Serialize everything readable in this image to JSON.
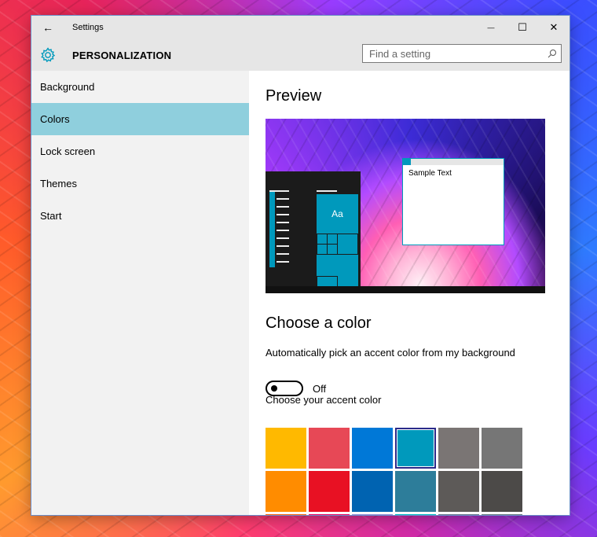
{
  "window": {
    "app_title": "Settings",
    "back_glyph": "←",
    "minimize_glyph": "—",
    "maximize_glyph": "☐",
    "close_glyph": "✕"
  },
  "header": {
    "title": "PERSONALIZATION",
    "search_placeholder": "Find a setting"
  },
  "sidebar": {
    "items": [
      {
        "label": "Background",
        "active": false
      },
      {
        "label": "Colors",
        "active": true
      },
      {
        "label": "Lock screen",
        "active": false
      },
      {
        "label": "Themes",
        "active": false
      },
      {
        "label": "Start",
        "active": false
      }
    ]
  },
  "main": {
    "preview_heading": "Preview",
    "preview": {
      "sample_text": "Sample Text",
      "tile_text": "Aa"
    },
    "choose_color_heading": "Choose a color",
    "auto_pick_label": "Automatically pick an accent color from my background",
    "toggle_state": "Off",
    "accent_label": "Choose your accent color",
    "accent_color": "#0099bc",
    "swatches": [
      [
        "#ffb900",
        "#e74856",
        "#0078d7",
        "#0099bc",
        "#7a7574",
        "#767676"
      ],
      [
        "#ff8c00",
        "#e81123",
        "#0063b1",
        "#2d7d9a",
        "#5d5a58",
        "#4c4a48"
      ],
      [
        "#f7630c",
        "#ea005e",
        "#8e8cd8",
        "#00b7c3",
        "#68768a",
        "#69797e"
      ]
    ],
    "selected_swatch": "#0099bc"
  }
}
